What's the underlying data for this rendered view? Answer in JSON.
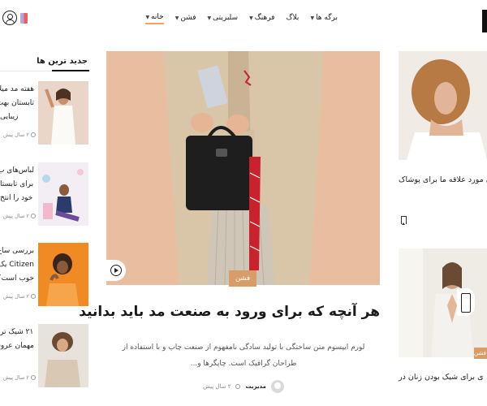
{
  "header": {
    "nav": [
      {
        "label": "خانه",
        "has_dropdown": true,
        "active": true
      },
      {
        "label": "فشن",
        "has_dropdown": true,
        "active": false
      },
      {
        "label": "سلبریتی",
        "has_dropdown": true,
        "active": false
      },
      {
        "label": "فرهنگ",
        "has_dropdown": true,
        "active": false
      },
      {
        "label": "بلاگ",
        "has_dropdown": false,
        "active": false
      },
      {
        "label": "برگه ها",
        "has_dropdown": true,
        "active": false
      }
    ],
    "icons": [
      "user-icon",
      "bag-icon"
    ]
  },
  "latest": {
    "title": "جدید ترین ها",
    "items": [
      {
        "title_lines": [
          "هفته مد میلا",
          "تابستان بهت",
          "زیبایی"
        ],
        "meta": "۲ سال پیش"
      },
      {
        "title_lines": [
          "لباس‌های ب",
          "برای تابستا",
          "خود را انتخ"
        ],
        "meta": "۲ سال پیش"
      },
      {
        "title_lines": [
          "بررسی ساع",
          "Citizen یک",
          "خوب است؟"
        ],
        "meta": "۲ سال پیش"
      },
      {
        "title_lines": [
          "۲۱ شیک تر",
          "مهمان عروس"
        ],
        "meta": "۲ سال پیش"
      }
    ]
  },
  "hero": {
    "category": "فشن",
    "title": "هر آنچه که برای ورود به صنعت مد باید بدانید",
    "excerpt": "لورم ایپسوم متن ساختگی با تولید سادگی نامفهوم از صنعت چاپ و با استفاده از طراحان گرافیک است. چاپگرها و...",
    "author": "مدیریت",
    "time": "۲ سال پیش"
  },
  "right": {
    "card1": {
      "title": "ی مورد علاقه ما برای پوشاک"
    },
    "card2": {
      "category": "فشن",
      "title": "ی برای شیک بودن زنان در"
    }
  },
  "colors": {
    "accent": "#d79c67",
    "active_underline": "#f4a460"
  }
}
